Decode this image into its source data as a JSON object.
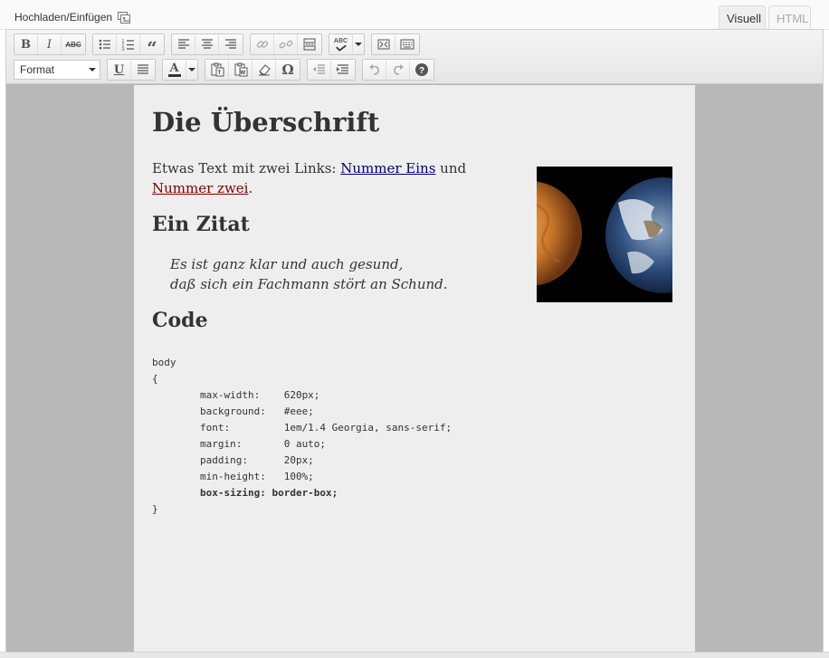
{
  "topbar": {
    "upload_label": "Hochladen/Einfügen",
    "upload_icon": "media-icon",
    "tabs": [
      {
        "label": "Visuell",
        "active": true
      },
      {
        "label": "HTML",
        "active": false
      }
    ]
  },
  "toolbar": {
    "row1": [
      {
        "name": "bold-button",
        "label": "B"
      },
      {
        "name": "italic-button",
        "label": "I"
      },
      {
        "name": "strikethrough-button",
        "label": "ABC"
      },
      {
        "name": "bullet-list-button",
        "icon": "bullet-list-icon"
      },
      {
        "name": "numbered-list-button",
        "icon": "numbered-list-icon"
      },
      {
        "name": "blockquote-button",
        "label": "“"
      },
      {
        "name": "align-left-button",
        "icon": "align-left-icon"
      },
      {
        "name": "align-center-button",
        "icon": "align-center-icon"
      },
      {
        "name": "align-right-button",
        "icon": "align-right-icon"
      },
      {
        "name": "link-button",
        "icon": "link-icon"
      },
      {
        "name": "unlink-button",
        "icon": "unlink-icon"
      },
      {
        "name": "more-tag-button",
        "icon": "more-tag-icon"
      },
      {
        "name": "spellcheck-button",
        "label": "ABC"
      },
      {
        "name": "fullscreen-button",
        "icon": "fullscreen-icon"
      },
      {
        "name": "kitchen-sink-button",
        "icon": "kitchen-sink-icon"
      }
    ],
    "format_label": "Format",
    "row2": [
      {
        "name": "underline-button",
        "label": "U"
      },
      {
        "name": "justify-button",
        "icon": "justify-icon"
      },
      {
        "name": "text-color-button",
        "label": "A"
      },
      {
        "name": "paste-text-button",
        "icon": "paste-text-icon"
      },
      {
        "name": "paste-word-button",
        "icon": "paste-word-icon"
      },
      {
        "name": "clear-format-button",
        "icon": "eraser-icon"
      },
      {
        "name": "special-char-button",
        "label": "Ω"
      },
      {
        "name": "outdent-button",
        "icon": "outdent-icon"
      },
      {
        "name": "indent-button",
        "icon": "indent-icon"
      },
      {
        "name": "undo-button",
        "icon": "undo-icon"
      },
      {
        "name": "redo-button",
        "icon": "redo-icon"
      },
      {
        "name": "help-button",
        "icon": "help-icon"
      }
    ]
  },
  "content": {
    "heading1": "Die Überschrift",
    "paragraph_prefix": "Etwas Text mit zwei Links: ",
    "link1": "Nummer Eins",
    "paragraph_middle": " und ",
    "link2": "Nummer zwei",
    "paragraph_suffix": ".",
    "heading2": "Ein Zitat",
    "quote_line1": "Es ist ganz klar und auch gesund,",
    "quote_line2": "daß sich ein Fachmann stört an Schund.",
    "heading3": "Code",
    "code_lines": [
      "body",
      "{",
      "        max-width:    620px;",
      "        background:   #eee;",
      "        font:         1em/1.4 Georgia, sans-serif;",
      "        margin:       0 auto;",
      "        padding:      20px;",
      "        min-height:   100%;",
      "        box-sizing: border-box;",
      "}"
    ],
    "image_alt": "planets-image"
  },
  "colors": {
    "link1": "#000080",
    "link2": "#800000",
    "page_bg": "#eeeeee",
    "outer_bg": "#b8b8b8"
  }
}
